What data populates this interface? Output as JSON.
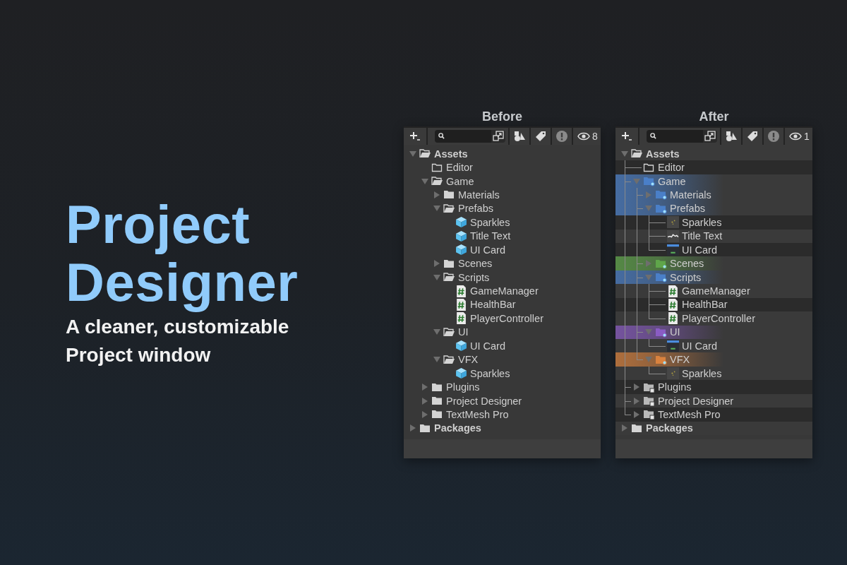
{
  "headline": {
    "title": "Project Designer",
    "subtitle": "A cleaner, customizable Project window"
  },
  "panels": [
    {
      "caption": "Before",
      "tree_lines": false,
      "striped": false,
      "toolbar": {
        "visibility_count": "8"
      },
      "tree": [
        {
          "name": "Assets",
          "kind": "folder",
          "expanded": true,
          "children": [
            {
              "name": "Editor",
              "kind": "empty_folder"
            },
            {
              "name": "Game",
              "kind": "folder",
              "expanded": true,
              "children": [
                {
                  "name": "Materials",
                  "kind": "folder",
                  "expanded": false
                },
                {
                  "name": "Prefabs",
                  "kind": "folder",
                  "expanded": true,
                  "children": [
                    {
                      "name": "Sparkles",
                      "kind": "prefab"
                    },
                    {
                      "name": "Title Text",
                      "kind": "prefab"
                    },
                    {
                      "name": "UI Card",
                      "kind": "prefab"
                    }
                  ]
                },
                {
                  "name": "Scenes",
                  "kind": "folder",
                  "expanded": false
                },
                {
                  "name": "Scripts",
                  "kind": "folder",
                  "expanded": true,
                  "children": [
                    {
                      "name": "GameManager",
                      "kind": "script"
                    },
                    {
                      "name": "HealthBar",
                      "kind": "script"
                    },
                    {
                      "name": "PlayerController",
                      "kind": "script"
                    }
                  ]
                },
                {
                  "name": "UI",
                  "kind": "folder",
                  "expanded": true,
                  "children": [
                    {
                      "name": "UI Card",
                      "kind": "prefab"
                    }
                  ]
                },
                {
                  "name": "VFX",
                  "kind": "folder",
                  "expanded": true,
                  "children": [
                    {
                      "name": "Sparkles",
                      "kind": "prefab"
                    }
                  ]
                }
              ]
            },
            {
              "name": "Plugins",
              "kind": "folder",
              "expanded": false
            },
            {
              "name": "Project Designer",
              "kind": "folder",
              "expanded": false
            },
            {
              "name": "TextMesh Pro",
              "kind": "folder",
              "expanded": false
            }
          ]
        },
        {
          "name": "Packages",
          "kind": "folder",
          "expanded": false
        }
      ]
    },
    {
      "caption": "After",
      "tree_lines": true,
      "striped": true,
      "toolbar": {
        "visibility_count": "1"
      },
      "tree": [
        {
          "name": "Assets",
          "kind": "folder",
          "expanded": true,
          "children": [
            {
              "name": "Editor",
              "kind": "empty_folder"
            },
            {
              "name": "Game",
              "kind": "folder",
              "expanded": true,
              "color": "#4a7fc8",
              "children": [
                {
                  "name": "Materials",
                  "kind": "folder",
                  "expanded": false,
                  "color": "#4a7fc8"
                },
                {
                  "name": "Prefabs",
                  "kind": "folder",
                  "expanded": true,
                  "color": "#4a7fc8",
                  "children": [
                    {
                      "name": "Sparkles",
                      "kind": "particle"
                    },
                    {
                      "name": "Title Text",
                      "kind": "text_prefab"
                    },
                    {
                      "name": "UI Card",
                      "kind": "card"
                    }
                  ]
                },
                {
                  "name": "Scenes",
                  "kind": "folder",
                  "expanded": false,
                  "color": "#5fa64a"
                },
                {
                  "name": "Scripts",
                  "kind": "folder",
                  "expanded": true,
                  "color": "#4a7fc8",
                  "children": [
                    {
                      "name": "GameManager",
                      "kind": "script"
                    },
                    {
                      "name": "HealthBar",
                      "kind": "script"
                    },
                    {
                      "name": "PlayerController",
                      "kind": "script"
                    }
                  ]
                },
                {
                  "name": "UI",
                  "kind": "folder",
                  "expanded": true,
                  "color": "#8a5cc4",
                  "children": [
                    {
                      "name": "UI Card",
                      "kind": "card"
                    }
                  ]
                },
                {
                  "name": "VFX",
                  "kind": "folder",
                  "expanded": true,
                  "color": "#d9823e",
                  "children": [
                    {
                      "name": "Sparkles",
                      "kind": "particle"
                    }
                  ]
                }
              ]
            },
            {
              "name": "Plugins",
              "kind": "badged_folder",
              "expanded": false
            },
            {
              "name": "Project Designer",
              "kind": "badged_folder",
              "expanded": false
            },
            {
              "name": "TextMesh Pro",
              "kind": "badged_folder",
              "expanded": false
            }
          ]
        },
        {
          "name": "Packages",
          "kind": "folder",
          "expanded": false
        }
      ]
    }
  ]
}
